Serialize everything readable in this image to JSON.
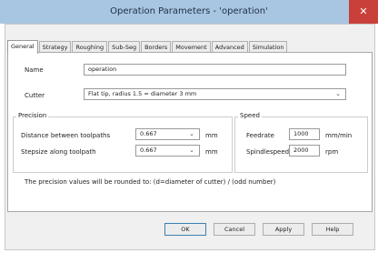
{
  "window": {
    "title": "Operation Parameters - 'operation'",
    "close_glyph": "✕"
  },
  "tabs": [
    {
      "label": "General",
      "active": true
    },
    {
      "label": "Strategy"
    },
    {
      "label": "Roughing"
    },
    {
      "label": "Sub-Seg"
    },
    {
      "label": "Borders"
    },
    {
      "label": "Movement"
    },
    {
      "label": "Advanced"
    },
    {
      "label": "Simulation"
    }
  ],
  "general": {
    "name_label": "Name",
    "name_value": "operation",
    "cutter_label": "Cutter",
    "cutter_value": "Flat tip, radius 1.5 = diameter 3 mm"
  },
  "precision": {
    "title": "Precision",
    "distance_label": "Distance between toolpaths",
    "distance_value": "0.667",
    "distance_unit": "mm",
    "stepsize_label": "Stepsize along toolpath",
    "stepsize_value": "0.667",
    "stepsize_unit": "mm"
  },
  "speed": {
    "title": "Speed",
    "feedrate_label": "Feedrate",
    "feedrate_value": "1000",
    "feedrate_unit": "mm/min",
    "spindle_label": "Spindlespeed",
    "spindle_value": "2000",
    "spindle_unit": "rpm"
  },
  "note": "The precision values will be rounded to: (d=diameter of cutter) / (odd number)",
  "buttons": {
    "ok": "OK",
    "cancel": "Cancel",
    "apply": "Apply",
    "help": "Help"
  },
  "icons": {
    "dropdown": "chevron-down-icon",
    "close": "close-icon"
  },
  "colors": {
    "titlebar": "#a8c6e2",
    "close": "#c9403a"
  }
}
